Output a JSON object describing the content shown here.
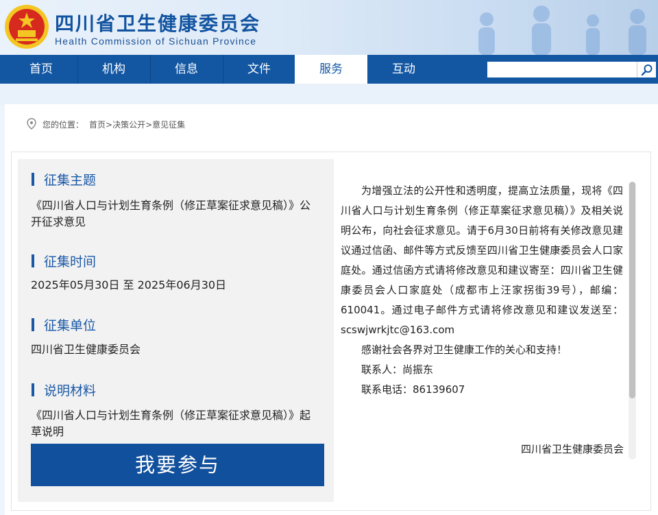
{
  "header": {
    "title": "四川省卫生健康委员会",
    "subtitle": "Health Commission of Sichuan Province"
  },
  "nav": {
    "items": [
      {
        "label": "首页"
      },
      {
        "label": "机构"
      },
      {
        "label": "信息"
      },
      {
        "label": "文件"
      },
      {
        "label": "服务",
        "active": true
      },
      {
        "label": "互动"
      }
    ],
    "search_value": ""
  },
  "breadcrumb": {
    "prefix": "您的位置：",
    "path": "首页>决策公开>意见征集"
  },
  "details": {
    "topic_heading": "征集主题",
    "topic": "《四川省人口与计划生育条例（修正草案征求意见稿）》公开征求意见",
    "time_heading": "征集时间",
    "time": "2025年05月30日 至 2025年06月30日",
    "unit_heading": "征集单位",
    "unit": "四川省卫生健康委员会",
    "material_heading": "说明材料",
    "material": "《四川省人口与计划生育条例（修正草案征求意见稿）》起草说明",
    "join_button": "我要参与"
  },
  "notice": {
    "body": "为增强立法的公开性和透明度，提高立法质量，现将《四川省人口与计划生育条例（修正草案征求意见稿）》及相关说明公布，向社会征求意见。请于6月30日前将有关修改意见建议通过信函、邮件等方式反馈至四川省卫生健康委员会人口家庭处。通过信函方式请将修改意见和建议寄至：四川省卫生健康委员会人口家庭处（成都市上汪家拐街39号），邮编：610041。通过电子邮件方式请将修改意见和建议发送至：scswjwrkjtc@163.com",
    "thanks": "感谢社会各界对卫生健康工作的关心和支持！",
    "contact": "联系人：尚振东",
    "phone": "联系电话：86139607",
    "signature": "四川省卫生健康委员会"
  },
  "colors": {
    "nav_blue": "#1357a3",
    "heading_blue": "#1a58a6",
    "button_blue": "#11509c"
  }
}
